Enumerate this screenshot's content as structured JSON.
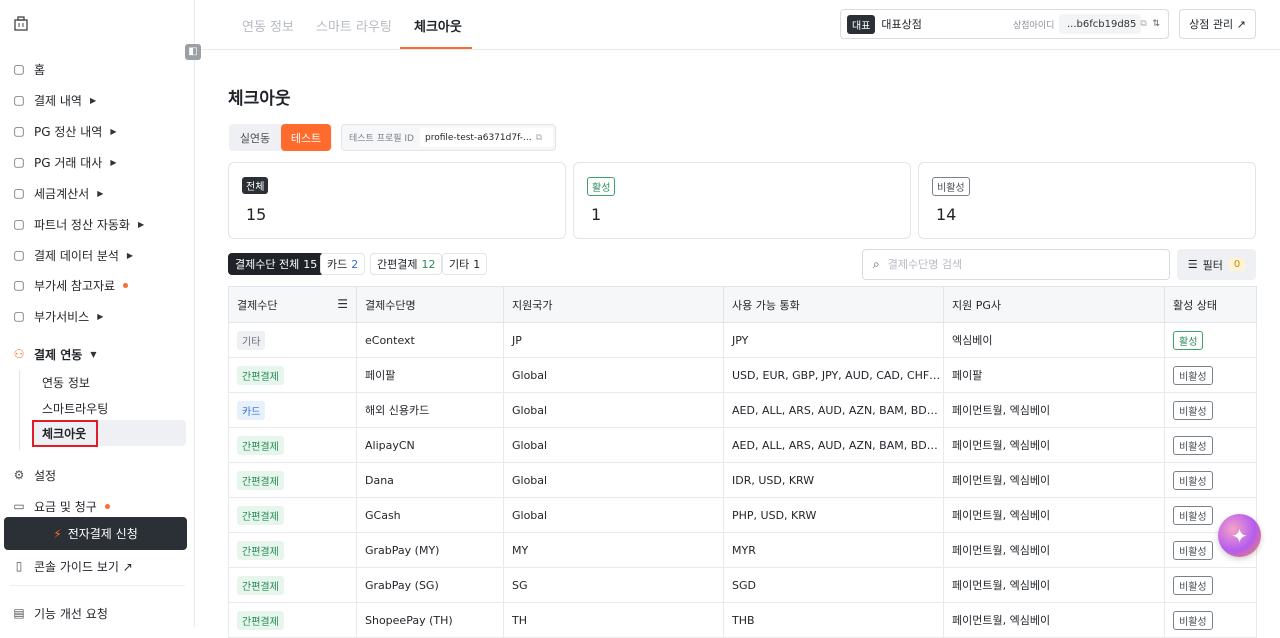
{
  "sidebar": {
    "nav": [
      {
        "label": "홈",
        "icon": "home-icon",
        "caret": false,
        "dot": false
      },
      {
        "label": "결제 내역",
        "icon": "clipboard-icon",
        "caret": true,
        "dot": false
      },
      {
        "label": "PG 정산 내역",
        "icon": "document-icon",
        "caret": true,
        "dot": false
      },
      {
        "label": "PG 거래 대사",
        "icon": "reconcile-icon",
        "caret": true,
        "dot": false
      },
      {
        "label": "세금계산서",
        "icon": "invoice-icon",
        "caret": true,
        "dot": false
      },
      {
        "label": "파트너 정산 자동화",
        "icon": "handshake-icon",
        "caret": true,
        "dot": false
      },
      {
        "label": "결제 데이터 분석",
        "icon": "chart-icon",
        "caret": true,
        "dot": false
      },
      {
        "label": "부가세 참고자료",
        "icon": "tax-icon",
        "caret": false,
        "dot": true
      },
      {
        "label": "부가서비스",
        "icon": "compass-icon",
        "caret": true,
        "dot": false
      },
      {
        "label": "결제 연동",
        "icon": "integration-icon",
        "caret": true,
        "dot": false
      }
    ],
    "sub_items": [
      "연동 정보",
      "스마트라우팅",
      "체크아웃"
    ],
    "settings_label": "설정",
    "billing_label": "요금 및 청구",
    "apply_label": "전자결제 신청",
    "guide_label": "콘솔 가이드 보기 ↗",
    "feedback_label": "기능 개선 요청"
  },
  "topbar": {
    "tabs": [
      "연동 정보",
      "스마트 라우팅",
      "체크아웃"
    ],
    "active_tab": "체크아웃",
    "store_badge": "대표",
    "store_name": "대표상점",
    "store_id_label": "상점아이디",
    "store_id": "...b6fcb19d85",
    "store_mgmt": "상점 관리 ↗"
  },
  "page": {
    "title": "체크아웃",
    "mode_live": "실연동",
    "mode_test": "테스트",
    "profile_label": "테스트 프로필 ID",
    "profile_id": "profile-test-a6371d7f-..."
  },
  "stats": [
    {
      "label": "전체",
      "value": "15",
      "style": "dark"
    },
    {
      "label": "활성",
      "value": "1",
      "style": "green"
    },
    {
      "label": "비활성",
      "value": "14",
      "style": "gray"
    }
  ],
  "chips": [
    {
      "label": "결제수단 전체",
      "count": "15"
    },
    {
      "label": "카드",
      "count": "2"
    },
    {
      "label": "간편결제",
      "count": "12"
    },
    {
      "label": "기타",
      "count": "1"
    }
  ],
  "search": {
    "placeholder": "결제수단명 검색"
  },
  "filter": {
    "label": "필터",
    "count": "0"
  },
  "table": {
    "columns": [
      "결제수단",
      "결제수단명",
      "지원국가",
      "사용 가능 통화",
      "지원 PG사",
      "활성 상태"
    ],
    "rows": [
      {
        "type": "기타",
        "type_style": "etc",
        "name": "eContext",
        "country": "JP",
        "currency": "JPY",
        "pg": "엑심베이",
        "status": "활성",
        "active": true
      },
      {
        "type": "간편결제",
        "type_style": "simple",
        "name": "페이팔",
        "country": "Global",
        "currency": "USD, EUR, GBP, JPY, AUD, CAD, CHF, ...",
        "pg": "페이팔",
        "status": "비활성",
        "active": false
      },
      {
        "type": "카드",
        "type_style": "card",
        "name": "해외 신용카드",
        "country": "Global",
        "currency": "AED, ALL, ARS, AUD, AZN, BAM, BDT, ...",
        "pg": "페이먼트월, 엑심베이",
        "status": "비활성",
        "active": false
      },
      {
        "type": "간편결제",
        "type_style": "simple",
        "name": "AlipayCN",
        "country": "Global",
        "currency": "AED, ALL, ARS, AUD, AZN, BAM, BDT, ...",
        "pg": "페이먼트월, 엑심베이",
        "status": "비활성",
        "active": false
      },
      {
        "type": "간편결제",
        "type_style": "simple",
        "name": "Dana",
        "country": "Global",
        "currency": "IDR, USD, KRW",
        "pg": "페이먼트월, 엑심베이",
        "status": "비활성",
        "active": false
      },
      {
        "type": "간편결제",
        "type_style": "simple",
        "name": "GCash",
        "country": "Global",
        "currency": "PHP, USD, KRW",
        "pg": "페이먼트월, 엑심베이",
        "status": "비활성",
        "active": false
      },
      {
        "type": "간편결제",
        "type_style": "simple",
        "name": "GrabPay (MY)",
        "country": "MY",
        "currency": "MYR",
        "pg": "페이먼트월, 엑심베이",
        "status": "비활성",
        "active": false
      },
      {
        "type": "간편결제",
        "type_style": "simple",
        "name": "GrabPay (SG)",
        "country": "SG",
        "currency": "SGD",
        "pg": "페이먼트월, 엑심베이",
        "status": "비활성",
        "active": false
      },
      {
        "type": "간편결제",
        "type_style": "simple",
        "name": "ShopeePay (TH)",
        "country": "TH",
        "currency": "THB",
        "pg": "페이먼트월, 엑심베이",
        "status": "비활성",
        "active": false
      }
    ]
  },
  "colors": {
    "accent": "#ff6b2c",
    "dark": "#2b2f36",
    "highlight_box": "#e11d2a"
  }
}
